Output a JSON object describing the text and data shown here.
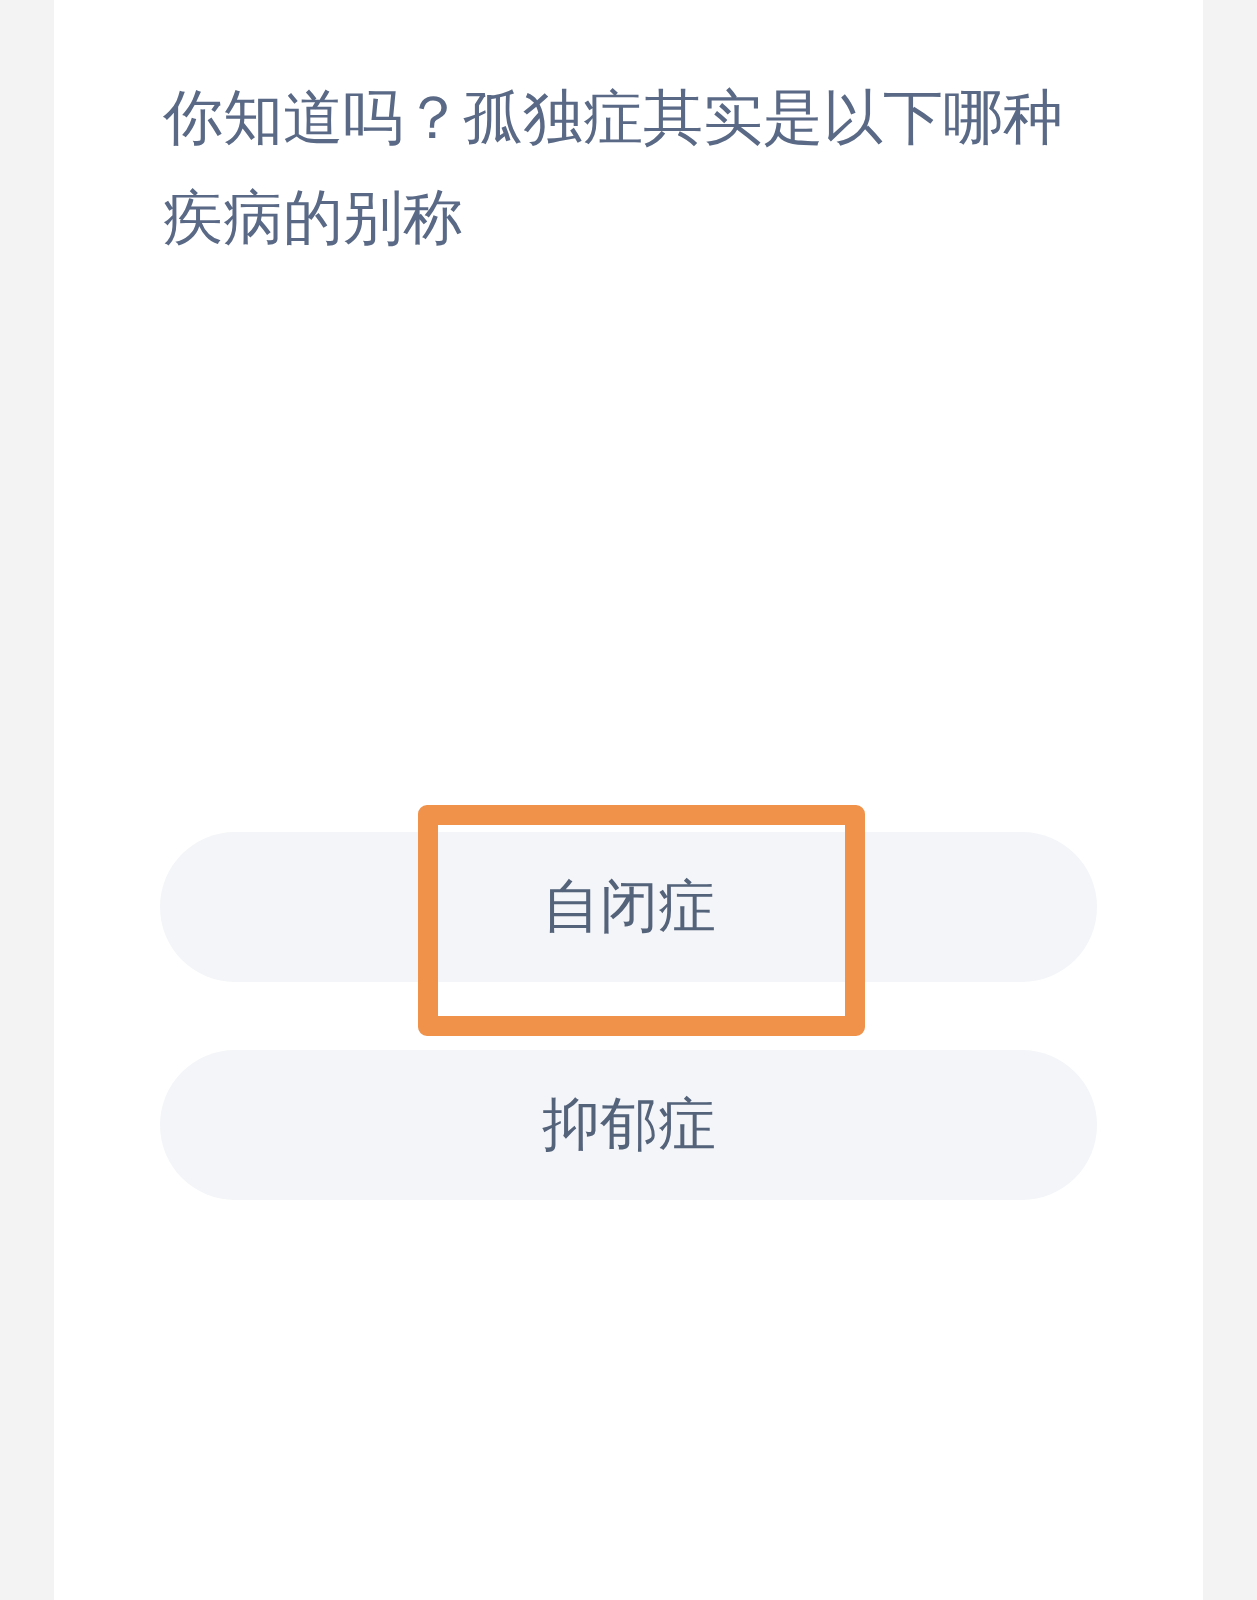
{
  "question": "你知道吗？孤独症其实是以下哪种疾病的别称",
  "options": [
    {
      "label": "自闭症",
      "highlighted": true
    },
    {
      "label": "抑郁症",
      "highlighted": false
    }
  ]
}
